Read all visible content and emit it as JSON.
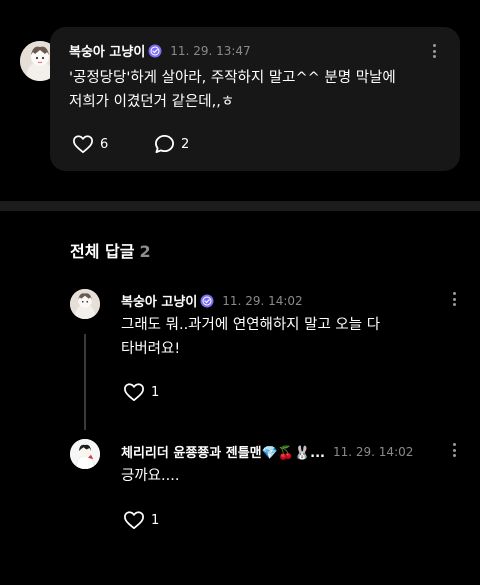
{
  "post": {
    "author": "복숭아 고냥이",
    "time": "11. 29. 13:47",
    "text_line1": "'공정당당'하게 살아라, 주작하지 말고^^ 분명 막날에",
    "text_line2": "저희가 이겼던거 같은데,,ㅎ",
    "likes": "6",
    "comments": "2"
  },
  "replies_header": {
    "title": "전체 답글",
    "count": "2"
  },
  "replies": [
    {
      "author": "복숭아 고냥이",
      "time": "11. 29. 14:02",
      "text_line1": "그래도 뭐..과거에 연연해하지 말고 오늘 다",
      "text_line2": "타버려요!",
      "likes": "1"
    },
    {
      "author": "체리리더 윤쭁쭁과 젠틀맨💎🍒🐰...",
      "time": "11. 29. 14:02",
      "text_line1": "긍까요....",
      "likes": "1"
    }
  ],
  "colors": {
    "background": "#000000",
    "card": "#171717",
    "band": "#1c1c1c",
    "muted": "#8a8a8a",
    "verified": "#7b6cf6"
  },
  "icons": [
    "verified-badge-icon",
    "more-options-icon",
    "heart-icon",
    "comment-icon",
    "avatar"
  ]
}
